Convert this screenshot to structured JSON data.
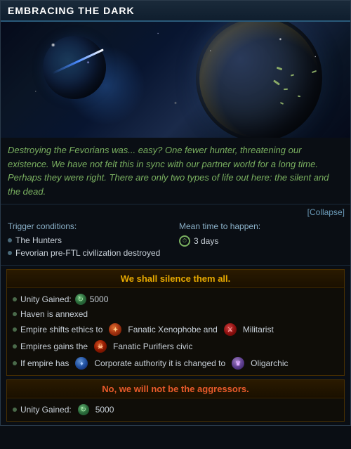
{
  "title": "EMBRACING THE DARK",
  "flavor_text": "Destroying the Fevorians was... easy? One fewer hunter, threatening our existence. We have not felt this in sync with our partner world for a long time. Perhaps they were right. There are only two types of life out here: the silent and the dead.",
  "collapse_button": "[Collapse]",
  "trigger_label": "Trigger conditions:",
  "mean_time_label": "Mean time to happen:",
  "triggers": [
    "The Hunters",
    "Fevorian pre-FTL civilization destroyed"
  ],
  "mean_time_value": "3 days",
  "option_yes": {
    "header": "We shall silence them all.",
    "effects": [
      {
        "text": "Unity Gained:",
        "value": "5000",
        "type": "unity"
      },
      {
        "text": "Haven is annexed",
        "type": "plain"
      },
      {
        "text": "Empire shifts ethics to",
        "post": "Fanatic Xenophobe and",
        "post2": "Militarist",
        "type": "ethics_shift"
      },
      {
        "text": "Empires gains the",
        "post": "Fanatic Purifiers civic",
        "type": "civic"
      },
      {
        "text": "If empire has",
        "post": "Corporate authority it is changed to",
        "post2": "Oligarchic",
        "type": "authority"
      }
    ]
  },
  "option_no": {
    "header": "No, we will not be the aggressors.",
    "effects": [
      {
        "text": "Unity Gained:",
        "value": "5000",
        "type": "unity"
      }
    ]
  }
}
